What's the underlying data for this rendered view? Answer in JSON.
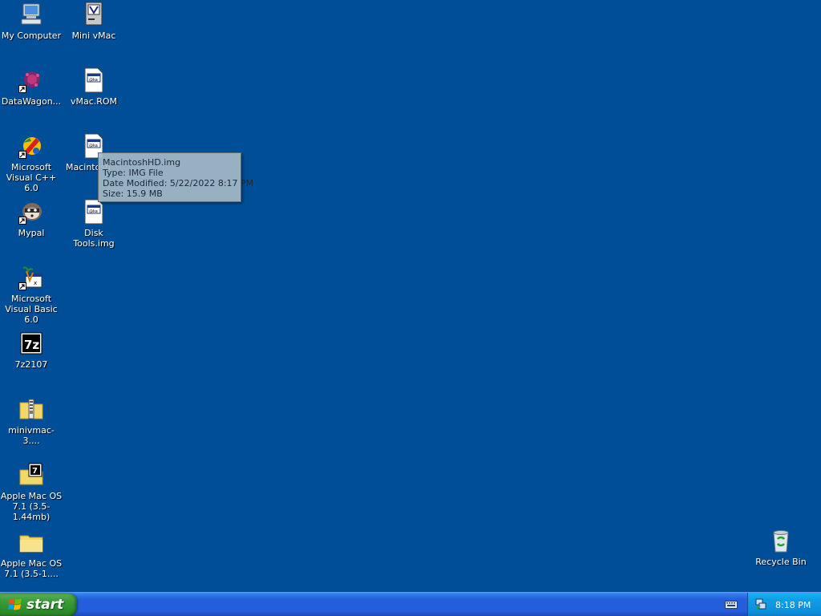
{
  "desktop": {
    "icons": [
      {
        "label": "My Computer",
        "icon": "my-computer-icon"
      },
      {
        "label": "Mini vMac",
        "icon": "mini-vmac-icon"
      },
      {
        "label": "DataWagon...",
        "icon": "datawagon-icon"
      },
      {
        "label": "vMac.ROM",
        "icon": "rom-file-icon"
      },
      {
        "label": "Microsoft Visual C++ 6.0",
        "icon": "visual-cpp-icon"
      },
      {
        "label": "MacintoshHD.img",
        "icon": "img-file-icon"
      },
      {
        "label": "Mypal",
        "icon": "mypal-icon"
      },
      {
        "label": "Disk Tools.img",
        "icon": "img-file-icon"
      },
      {
        "label": "Microsoft Visual Basic 6.0",
        "icon": "visual-basic-icon"
      },
      {
        "label": "7z2107",
        "icon": "7zip-icon"
      },
      {
        "label": "minivmac-3....",
        "icon": "zip-folder-icon"
      },
      {
        "label": "Apple Mac OS 7.1 (3.5-1.44mb)",
        "icon": "7z-archive-icon"
      },
      {
        "label": "Apple Mac OS 7.1 (3.5-1....",
        "icon": "folder-icon"
      },
      {
        "label": "Recycle Bin",
        "icon": "recycle-bin-icon"
      }
    ],
    "partial_label_macintosh": "Macintosh"
  },
  "tooltip": {
    "name": "MacintoshHD.img",
    "type": "Type: IMG File",
    "modified": "Date Modified: 5/22/2022 8:17 PM",
    "size": "Size: 15.9 MB"
  },
  "taskbar": {
    "start_label": "start",
    "clock": "8:18 PM"
  },
  "colors": {
    "desktop": "#004E98",
    "taskbar": "#245EDB",
    "start": "#3C9D3A",
    "tray": "#0F9DE6"
  }
}
